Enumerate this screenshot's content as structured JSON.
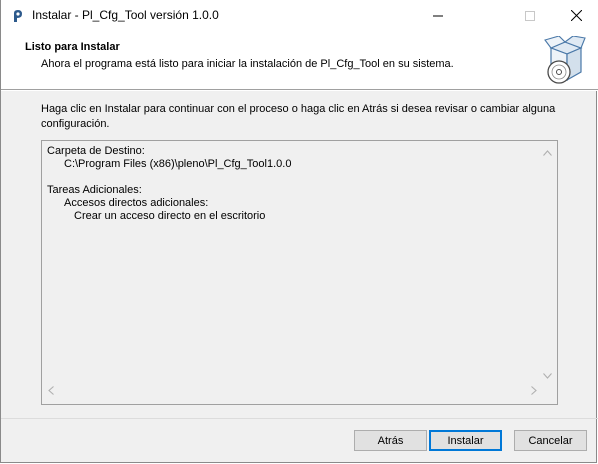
{
  "window": {
    "title": "Instalar - Pl_Cfg_Tool versión 1.0.0"
  },
  "header": {
    "title": "Listo para Instalar",
    "subtitle": "Ahora el programa está listo para iniciar la instalación de Pl_Cfg_Tool en su sistema."
  },
  "body": {
    "instructions": "Haga clic en Instalar para continuar con el proceso o haga clic en Atrás si desea revisar o cambiar alguna configuración."
  },
  "memo": {
    "dest_label": "Carpeta de Destino:",
    "dest_path": "C:\\Program Files (x86)\\pleno\\Pl_Cfg_Tool1.0.0",
    "tasks_label": "Tareas Adicionales:",
    "shortcuts_label": "Accesos directos adicionales:",
    "desktop_shortcut": "Crear un acceso directo en el escritorio"
  },
  "buttons": {
    "back": "Atrás",
    "install": "Instalar",
    "cancel": "Cancelar"
  },
  "icons": {
    "app": "installer-icon",
    "minimize": "minimize-icon",
    "maximize": "maximize-icon",
    "close": "close-icon",
    "wizard": "box-disc-icon"
  }
}
